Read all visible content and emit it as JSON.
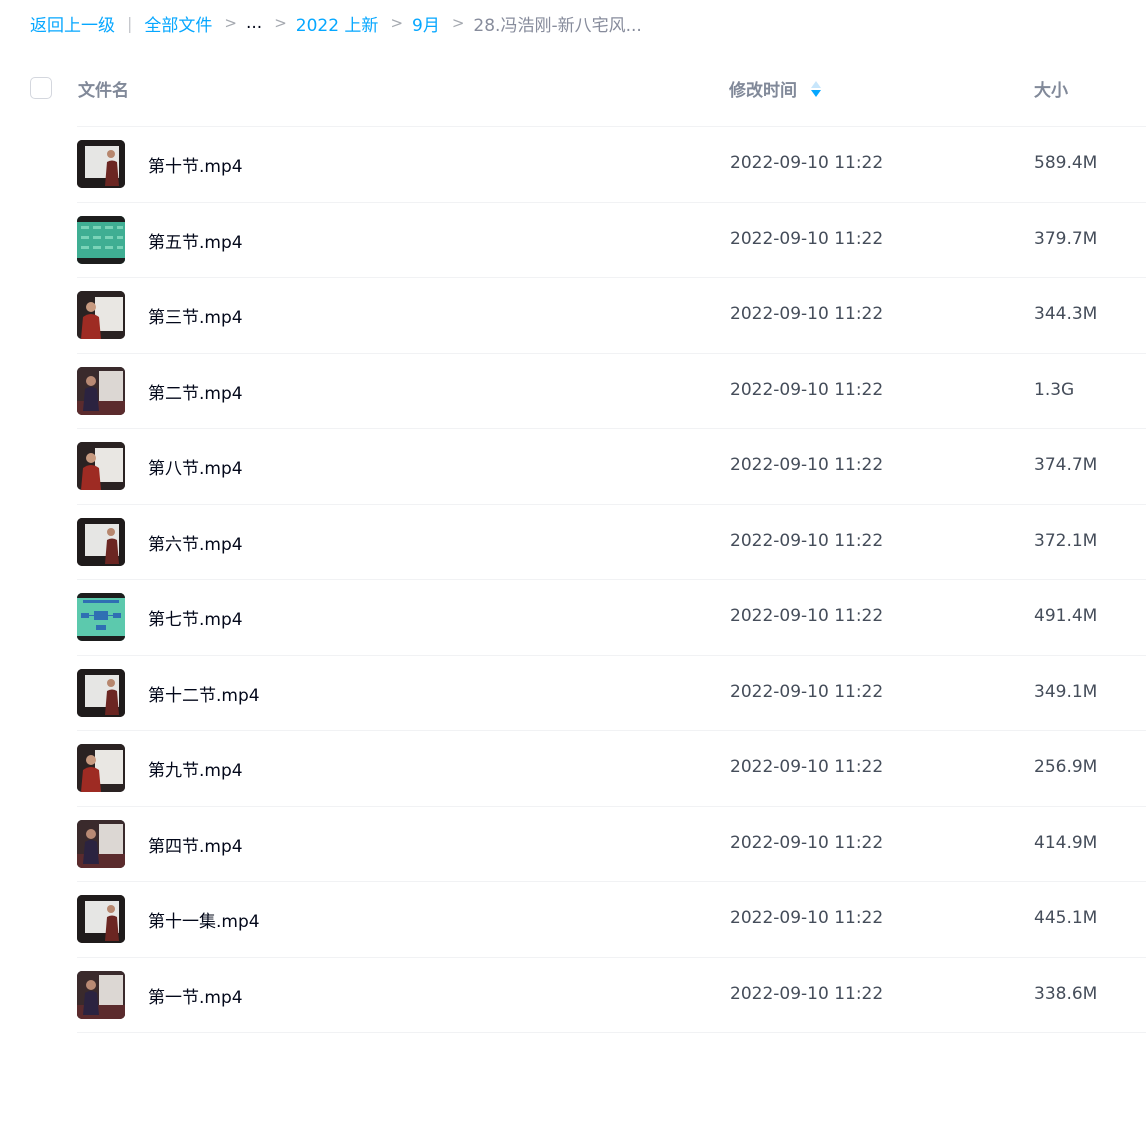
{
  "breadcrumb": {
    "back": "返回上一级",
    "all_files": "全部文件",
    "ellipsis": "...",
    "folder_2022": "2022 上新",
    "folder_month": "9月",
    "current": "28.冯浩刚-新八宅风..."
  },
  "table": {
    "col_name": "文件名",
    "col_time": "修改时间",
    "col_size": "大小",
    "sort_icon": "sort-descending-icon"
  },
  "colors": {
    "link": "#06a7ff",
    "text_primary": "#03081a",
    "text_secondary": "#454d5a"
  },
  "files": [
    {
      "name": "第十节.mp4",
      "time": "2022-09-10 11:22",
      "size": "589.4M",
      "thumb": "lecture-whiteboard"
    },
    {
      "name": "第五节.mp4",
      "time": "2022-09-10 11:22",
      "size": "379.7M",
      "thumb": "green-table"
    },
    {
      "name": "第三节.mp4",
      "time": "2022-09-10 11:22",
      "size": "344.3M",
      "thumb": "speaker-red"
    },
    {
      "name": "第二节.mp4",
      "time": "2022-09-10 11:22",
      "size": "1.3G",
      "thumb": "speaker-dark"
    },
    {
      "name": "第八节.mp4",
      "time": "2022-09-10 11:22",
      "size": "374.7M",
      "thumb": "speaker-red"
    },
    {
      "name": "第六节.mp4",
      "time": "2022-09-10 11:22",
      "size": "372.1M",
      "thumb": "lecture-whiteboard"
    },
    {
      "name": "第七节.mp4",
      "time": "2022-09-10 11:22",
      "size": "491.4M",
      "thumb": "green-diagram"
    },
    {
      "name": "第十二节.mp4",
      "time": "2022-09-10 11:22",
      "size": "349.1M",
      "thumb": "lecture-whiteboard"
    },
    {
      "name": "第九节.mp4",
      "time": "2022-09-10 11:22",
      "size": "256.9M",
      "thumb": "speaker-red"
    },
    {
      "name": "第四节.mp4",
      "time": "2022-09-10 11:22",
      "size": "414.9M",
      "thumb": "speaker-dark"
    },
    {
      "name": "第十一集.mp4",
      "time": "2022-09-10 11:22",
      "size": "445.1M",
      "thumb": "lecture-whiteboard"
    },
    {
      "name": "第一节.mp4",
      "time": "2022-09-10 11:22",
      "size": "338.6M",
      "thumb": "speaker-dark"
    }
  ]
}
